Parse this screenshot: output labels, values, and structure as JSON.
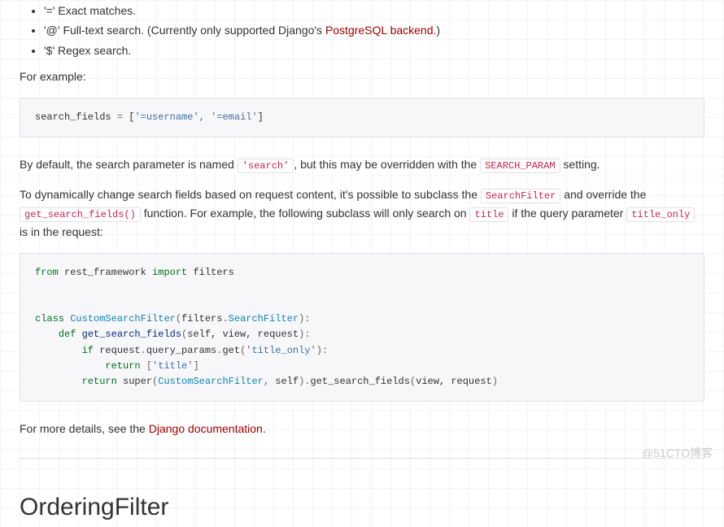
{
  "bullets": [
    {
      "label": "'=' Exact matches."
    },
    {
      "prefix": "'@' Full-text search. (Currently only supported Django's ",
      "link": "PostgreSQL backend",
      "suffix": ".)"
    },
    {
      "label": "'$' Regex search."
    }
  ],
  "p1": "For example:",
  "code1": "search_fields = ['=username', '=email']",
  "p2": {
    "t1": "By default, the search parameter is named ",
    "c1": "'search'",
    "t2": ", but this may be overridden with the ",
    "c2": "SEARCH_PARAM",
    "t3": " setting."
  },
  "p3": {
    "t1": "To dynamically change search fields based on request content, it's possible to subclass the ",
    "c1": "SearchFilter",
    "t2": " and override the ",
    "c2": "get_search_fields()",
    "t3": " function. For example, the following subclass will only search on ",
    "c3": "title",
    "t4": " if the query parameter ",
    "c4": "title_only",
    "t5": " is in the request:"
  },
  "code2": {
    "from": "from",
    "mod": "rest_framework",
    "import": "import",
    "filters": "filters",
    "class": "class",
    "cls": "CustomSearchFilter",
    "baseA": "filters",
    "baseB": "SearchFilter",
    "def": "def",
    "fn": "get_search_fields",
    "args": "self, view, request",
    "if": "if",
    "expr1a": "request",
    "expr1b": "query_params",
    "expr1c": "get",
    "arg1": "'title_only'",
    "ret": "return",
    "ret1": "'title'",
    "superfn": "super",
    "superarg1": "CustomSearchFilter",
    "superarg2": "self",
    "tailfn": "get_search_fields",
    "tailargs": "view, request"
  },
  "p4": {
    "t1": "For more details, see the ",
    "link": "Django documentation",
    "t2": "."
  },
  "h2": "OrderingFilter",
  "watermark": "@51CTO博客"
}
